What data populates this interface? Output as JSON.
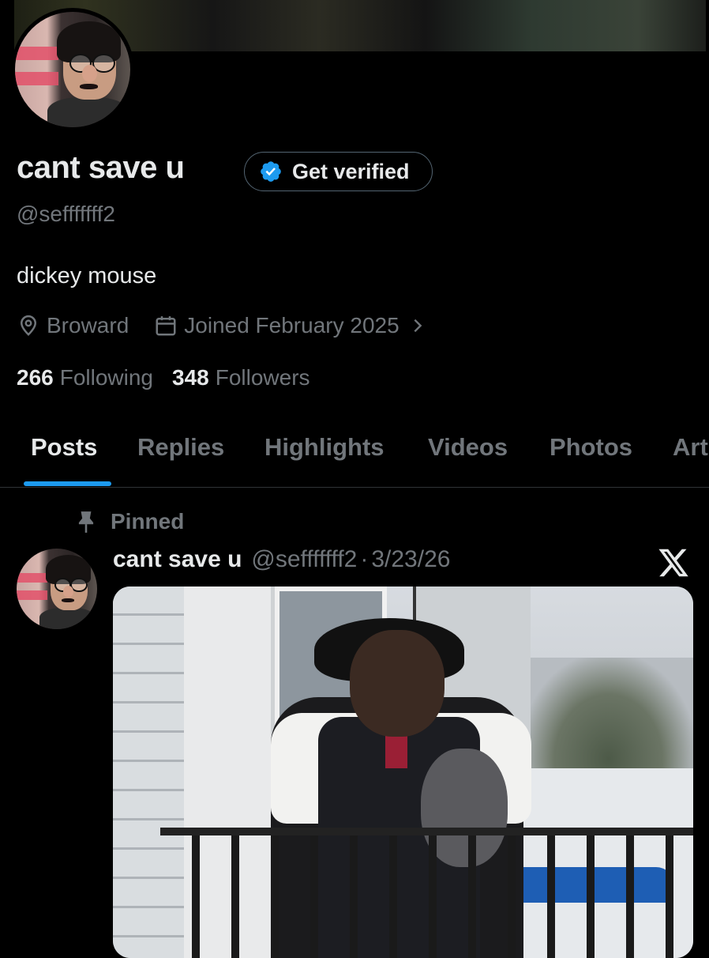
{
  "profile": {
    "display_name": "cant save u",
    "get_verified_label": "Get verified",
    "handle": "@sefffffff2",
    "bio": "dickey mouse",
    "location": "Broward",
    "joined": "Joined February 2025",
    "following_count": "266",
    "following_label": "Following",
    "followers_count": "348",
    "followers_label": "Followers"
  },
  "tabs": [
    {
      "label": "Posts",
      "active": true
    },
    {
      "label": "Replies"
    },
    {
      "label": "Highlights"
    },
    {
      "label": "Videos"
    },
    {
      "label": "Photos"
    },
    {
      "label": "Art"
    }
  ],
  "pinned_post": {
    "pinned_label": "Pinned",
    "author_name": "cant save u",
    "author_handle": "@sefffffff2",
    "separator": "·",
    "date": "3/23/26"
  },
  "colors": {
    "background": "#000000",
    "accent": "#1d9bf0",
    "muted_text": "#71767b",
    "primary_text": "#e7e9ea"
  },
  "icons": [
    "location-pin-icon",
    "calendar-icon",
    "chevron-right-icon",
    "verified-badge-icon",
    "pin-icon",
    "x-logo-icon"
  ]
}
